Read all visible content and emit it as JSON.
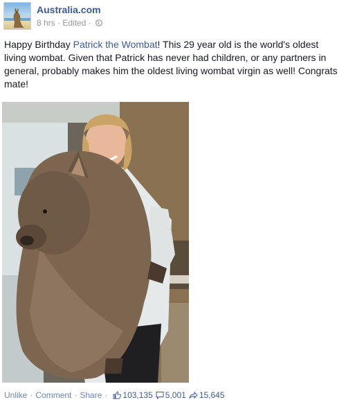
{
  "header": {
    "page_name": "Australia.com",
    "time": "8 hrs",
    "separator": "·",
    "edited": "Edited",
    "separator2": "·"
  },
  "post": {
    "text_before_link": "Happy Birthday ",
    "link_text": "Patrick the Wombat",
    "text_after_link": "! This 29 year old is the world's oldest living wombat. Given that Patrick has never had children, or any partners in general, probably makes him the oldest living wombat virgin as well! Congrats mate!"
  },
  "actions": {
    "unlike": "Unlike",
    "comment": "Comment",
    "share": "Share",
    "dot": "·",
    "likes_count": "103,135",
    "comments_count": "5,001",
    "shares_count": "15,645"
  },
  "icons": {
    "avatar": "kangaroo-avatar-icon",
    "globe": "globe-icon",
    "like": "thumbs-up-icon",
    "comment": "comment-icon",
    "share": "share-arrow-icon"
  },
  "colors": {
    "link": "#3b5998",
    "action": "#6d84b4",
    "meta": "#9197a3",
    "text": "#141823"
  }
}
